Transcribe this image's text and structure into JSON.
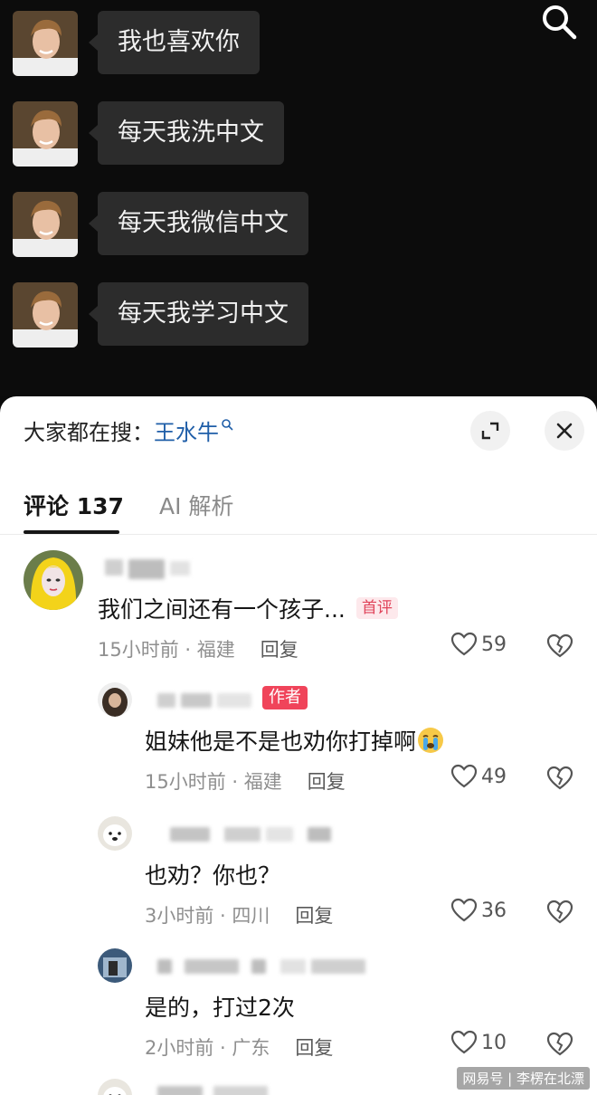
{
  "video": {
    "messages": [
      {
        "text": "我也喜欢你"
      },
      {
        "text": "每天我洗中文"
      },
      {
        "text": "每天我微信中文"
      },
      {
        "text": "每天我学习中文"
      }
    ],
    "search_icon": "search-icon"
  },
  "sheet": {
    "trend_label": "大家都在搜：",
    "trend_keyword": "王水牛",
    "expand_icon": "expand-icon",
    "close_icon": "close-icon",
    "tabs": [
      {
        "label": "评论 137",
        "active": true
      },
      {
        "label": "AI 解析",
        "active": false
      }
    ]
  },
  "comments": [
    {
      "text": "我们之间还有一个孩子...",
      "badge": "首评",
      "time": "15小时前",
      "location": "福建",
      "reply": "回复",
      "likes": "59"
    },
    {
      "text": "姐妹他是不是也劝你打掉啊",
      "badge": "作者",
      "emoji": "crying-face-emoji",
      "time": "15小时前",
      "location": "福建",
      "reply": "回复",
      "likes": "49"
    },
    {
      "text": "也劝？你也？",
      "time": "3小时前",
      "location": "四川",
      "reply": "回复",
      "likes": "36"
    },
    {
      "text": "是的，打过2次",
      "time": "2小时前",
      "location": "广东",
      "reply": "回复",
      "likes": "10"
    }
  ],
  "watermark": "网易号 | 李楞在北漂"
}
